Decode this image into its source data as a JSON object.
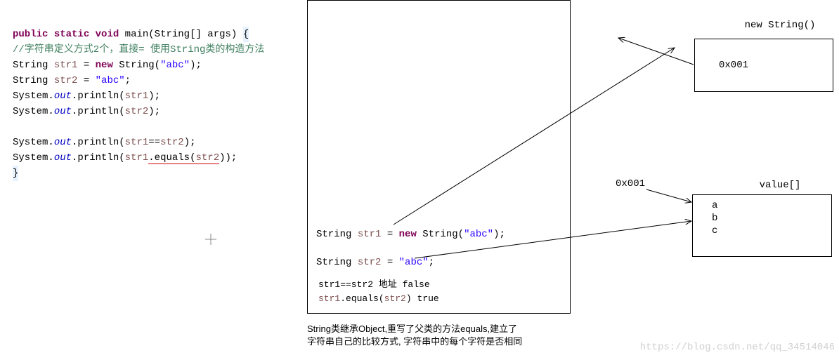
{
  "code": {
    "line1": {
      "public": "public",
      "static": "static",
      "void": "void",
      "main": "main(String[] args) ",
      "brace": "{"
    },
    "comment": "//字符串定义方式2个，直接=   使用String类的构造方法",
    "line2_type": "String ",
    "line2_var": "str1",
    "line2_eq": " = ",
    "line2_new": "new",
    "line2_rest": " String(",
    "line2_str": "\"abc\"",
    "line2_end": ");",
    "line3_type": "String ",
    "line3_var": "str2",
    "line3_eq": " = ",
    "line3_str": "\"abc\"",
    "line3_end": ";",
    "line4_sys": "System.",
    "line4_out": "out",
    "line4_print": ".println(",
    "line4_var": "str1",
    "line4_end": ");",
    "line5_var": "str2",
    "line6_cmp_a": "str1",
    "line6_cmp_op": "==",
    "line6_cmp_b": "str2",
    "line7_a": "str1",
    "line7_eq": ".equals(",
    "line7_b": "str2",
    "line7_end": "));",
    "close": "}"
  },
  "diagram": {
    "line1_type": "String ",
    "line1_var": "str1",
    "line1_eq": " = ",
    "line1_new": "new",
    "line1_rest": " String(",
    "line1_str": "\"abc\"",
    "line1_end": ");",
    "line2_type": "String ",
    "line2_var": "str2",
    "line2_eq": " = ",
    "line2_str": "\"abc\"",
    "line2_end": ";",
    "text1_a": "str1==str2 地址  false",
    "text2_a": "str1",
    "text2_b": ".equals(",
    "text2_c": "str2",
    "text2_d": ")   true"
  },
  "heap": {
    "newstring_label": "new String()",
    "addr": "0x001",
    "value_label": "value[]",
    "a": "a",
    "b": "b",
    "c": "c",
    "addr_label": "0x001"
  },
  "note": {
    "l1": "String类继承Object,重写了父类的方法equals,建立了",
    "l2": "字符串自己的比较方式, 字符串中的每个字符是否相同"
  },
  "watermark": "https://blog.csdn.net/qq_34514046"
}
